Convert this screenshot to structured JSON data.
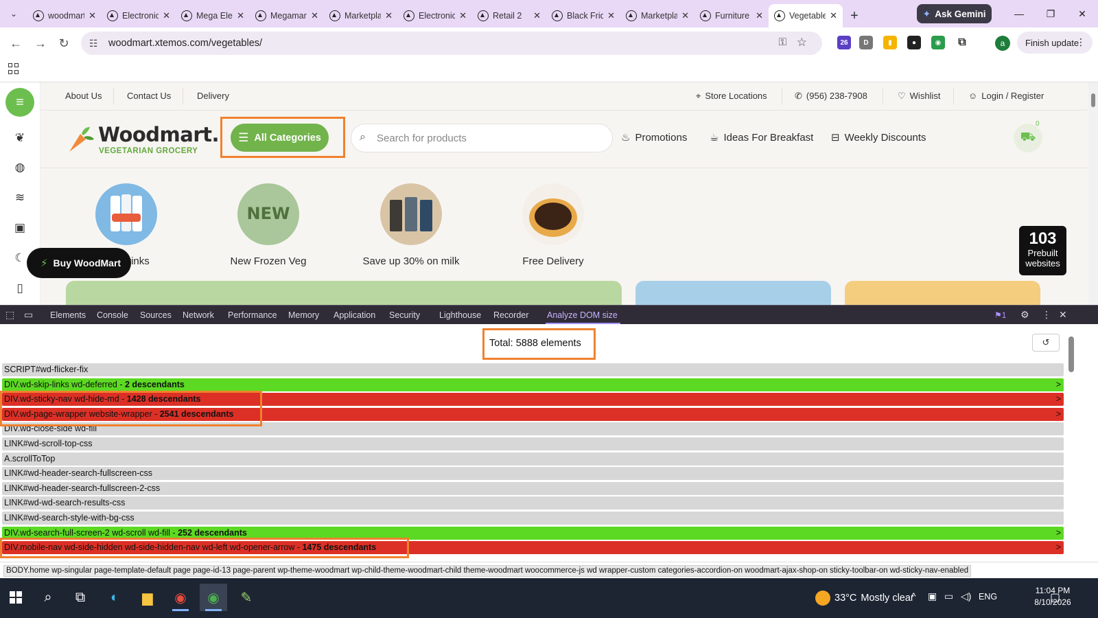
{
  "browser": {
    "tabs": [
      {
        "label": "woodmart"
      },
      {
        "label": "Electronics"
      },
      {
        "label": "Mega Electronics"
      },
      {
        "label": "Megamarket"
      },
      {
        "label": "Marketplace"
      },
      {
        "label": "Electronics"
      },
      {
        "label": "Retail 2"
      },
      {
        "label": "Black Friday"
      },
      {
        "label": "Marketplace"
      },
      {
        "label": "Furniture"
      },
      {
        "label": "Vegetables"
      }
    ],
    "active_tab_index": 10,
    "ask_gemini_label": "Ask Gemini",
    "url": "woodmart.xtemos.com/vegetables/",
    "extension_badge": "26",
    "profile_initial": "a",
    "finish_update_label": "Finish update"
  },
  "site": {
    "top_links": [
      "About Us",
      "Contact Us",
      "Delivery"
    ],
    "store_locations": "Store Locations",
    "phone": "(956) 238-7908",
    "wishlist": "Wishlist",
    "login": "Login / Register",
    "logo_name": "Woodmart.",
    "logo_tagline": "VEGETARIAN GROCERY",
    "all_categories": "All Categories",
    "search_placeholder": "Search for products",
    "nav_links": [
      "Promotions",
      "Ideas For Breakfast",
      "Weekly Discounts"
    ],
    "cart_count": "0",
    "promos": [
      {
        "label": "Energy Drinks",
        "visible_label": "rgy Drinks"
      },
      {
        "label": "New Frozen Veg",
        "badge": "NEW"
      },
      {
        "label": "Save up 30% on milk"
      },
      {
        "label": "Free Delivery"
      }
    ],
    "buy_button": "Buy WoodMart",
    "prebuilt_count": "103",
    "prebuilt_label_1": "Prebuilt",
    "prebuilt_label_2": "websites",
    "accent_color": "#72b34c"
  },
  "devtools": {
    "tabs": [
      "Elements",
      "Console",
      "Sources",
      "Network",
      "Performance",
      "Memory",
      "Application",
      "Security",
      "Lighthouse",
      "Recorder",
      "Analyze DOM size"
    ],
    "active_tab": "Analyze DOM size",
    "issues_count": "1",
    "total_label": "Total:",
    "total_value": "5888 elements",
    "rows": [
      {
        "text": "SCRIPT#wd-flicker-fix",
        "count": "",
        "color": "gray",
        "expandable": false
      },
      {
        "text": "DIV.wd-skip-links wd-deferred - ",
        "count": "2 descendants",
        "color": "green",
        "expandable": true
      },
      {
        "text": "DIV.wd-sticky-nav wd-hide-md - ",
        "count": "1428 descendants",
        "color": "red",
        "expandable": true
      },
      {
        "text": "DIV.wd-page-wrapper website-wrapper - ",
        "count": "2541 descendants",
        "color": "red",
        "expandable": true
      },
      {
        "text": "DIV.wd-close-side wd-fill",
        "count": "",
        "color": "gray",
        "expandable": false
      },
      {
        "text": "LINK#wd-scroll-top-css",
        "count": "",
        "color": "gray",
        "expandable": false
      },
      {
        "text": "A.scrollToTop",
        "count": "",
        "color": "gray",
        "expandable": false
      },
      {
        "text": "LINK#wd-header-search-fullscreen-css",
        "count": "",
        "color": "gray",
        "expandable": false
      },
      {
        "text": "LINK#wd-header-search-fullscreen-2-css",
        "count": "",
        "color": "gray",
        "expandable": false
      },
      {
        "text": "LINK#wd-wd-search-results-css",
        "count": "",
        "color": "gray",
        "expandable": false
      },
      {
        "text": "LINK#wd-search-style-with-bg-css",
        "count": "",
        "color": "gray",
        "expandable": false
      },
      {
        "text": "DIV.wd-search-full-screen-2 wd-scroll wd-fill - ",
        "count": "252 descendants",
        "color": "green",
        "expandable": true
      },
      {
        "text": "DIV.mobile-nav wd-side-hidden wd-side-hidden-nav wd-left wd-opener-arrow - ",
        "count": "1475 descendants",
        "color": "red",
        "expandable": true
      }
    ],
    "expand_glyph": ">",
    "breadcrumb": "BODY.home wp-singular page-template-default page page-id-13 page-parent wp-theme-woodmart wp-child-theme-woodmart-child theme-woodmart woocommerce-js wd wrapper-custom categories-accordion-on woodmart-ajax-shop-on sticky-toolbar-on wd-sticky-nav-enabled"
  },
  "taskbar": {
    "temperature": "33°C",
    "weather": "Mostly clear",
    "language": "ENG",
    "time": "11:04 PM",
    "date": "8/10/2026"
  }
}
